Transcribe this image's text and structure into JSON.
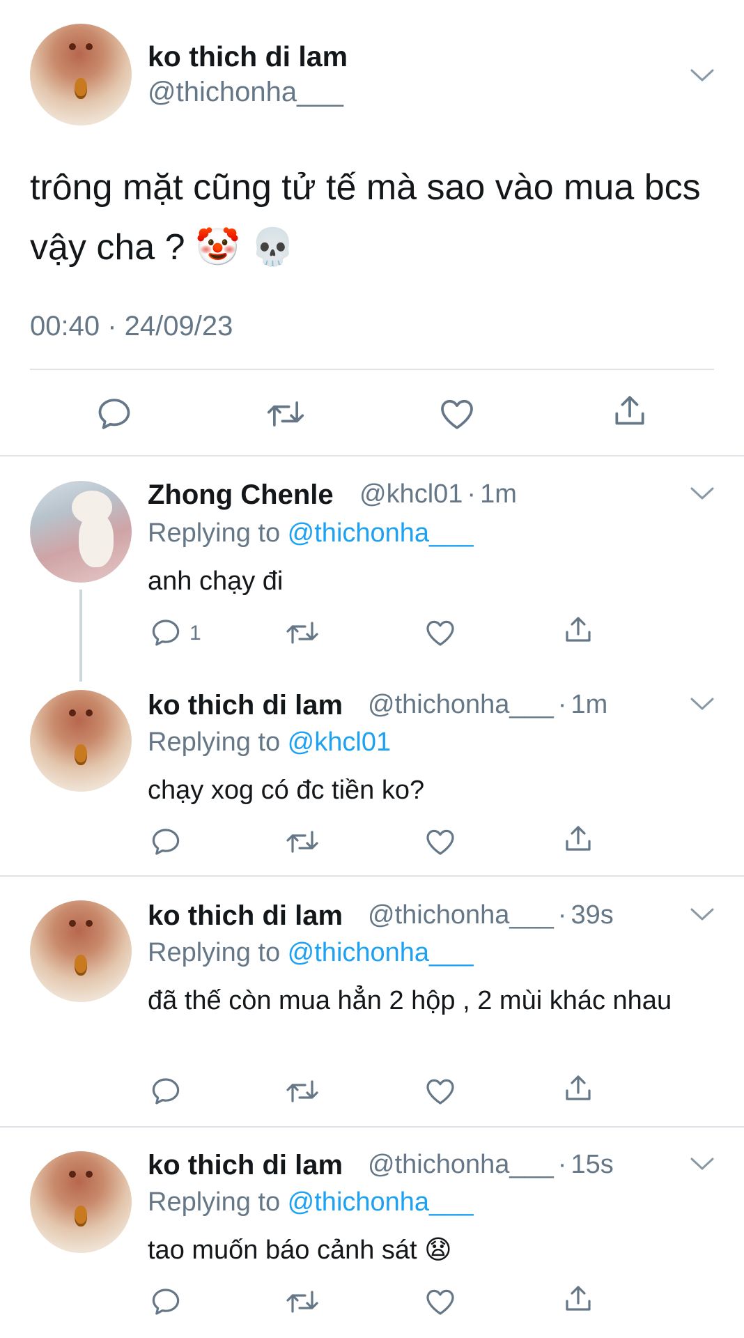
{
  "main_tweet": {
    "name": "ko thich di lam",
    "handle": "@thichonha___",
    "text": " trông mặt cũng tử tế mà sao vào mua bcs vậy cha ? 🤡 💀",
    "timestamp": "00:40 · 24/09/23"
  },
  "replies": [
    {
      "name": "Zhong Chenle",
      "handle": "@khcl01",
      "time": "1m",
      "replying_prefix": "Replying to ",
      "replying_to": "@thichonha___",
      "text": "anh chạy đi",
      "reply_count": "1"
    },
    {
      "name": "ko thich di lam",
      "handle": "@thichonha___",
      "time": "1m",
      "replying_prefix": "Replying to ",
      "replying_to": "@khcl01",
      "text": "chạy xog có đc tiền ko?"
    },
    {
      "name": "ko thich di lam",
      "handle": "@thichonha___",
      "time": "39s",
      "replying_prefix": "Replying to ",
      "replying_to": "@thichonha___",
      "text": "đã thế còn mua hẳn 2 hộp , 2 mùi khác nhau"
    },
    {
      "name": "ko thich di lam",
      "handle": "@thichonha___",
      "time": "15s",
      "replying_prefix": "Replying to ",
      "replying_to": "@thichonha___",
      "text": "tao muốn báo cảnh sát 😧"
    }
  ],
  "icons": [
    "chevron-down-icon",
    "reply-icon",
    "retweet-icon",
    "like-icon",
    "share-icon"
  ],
  "colors": {
    "link": "#1da1f2",
    "muted": "#657786",
    "text": "#14171a",
    "divider": "#dfe3e7"
  }
}
